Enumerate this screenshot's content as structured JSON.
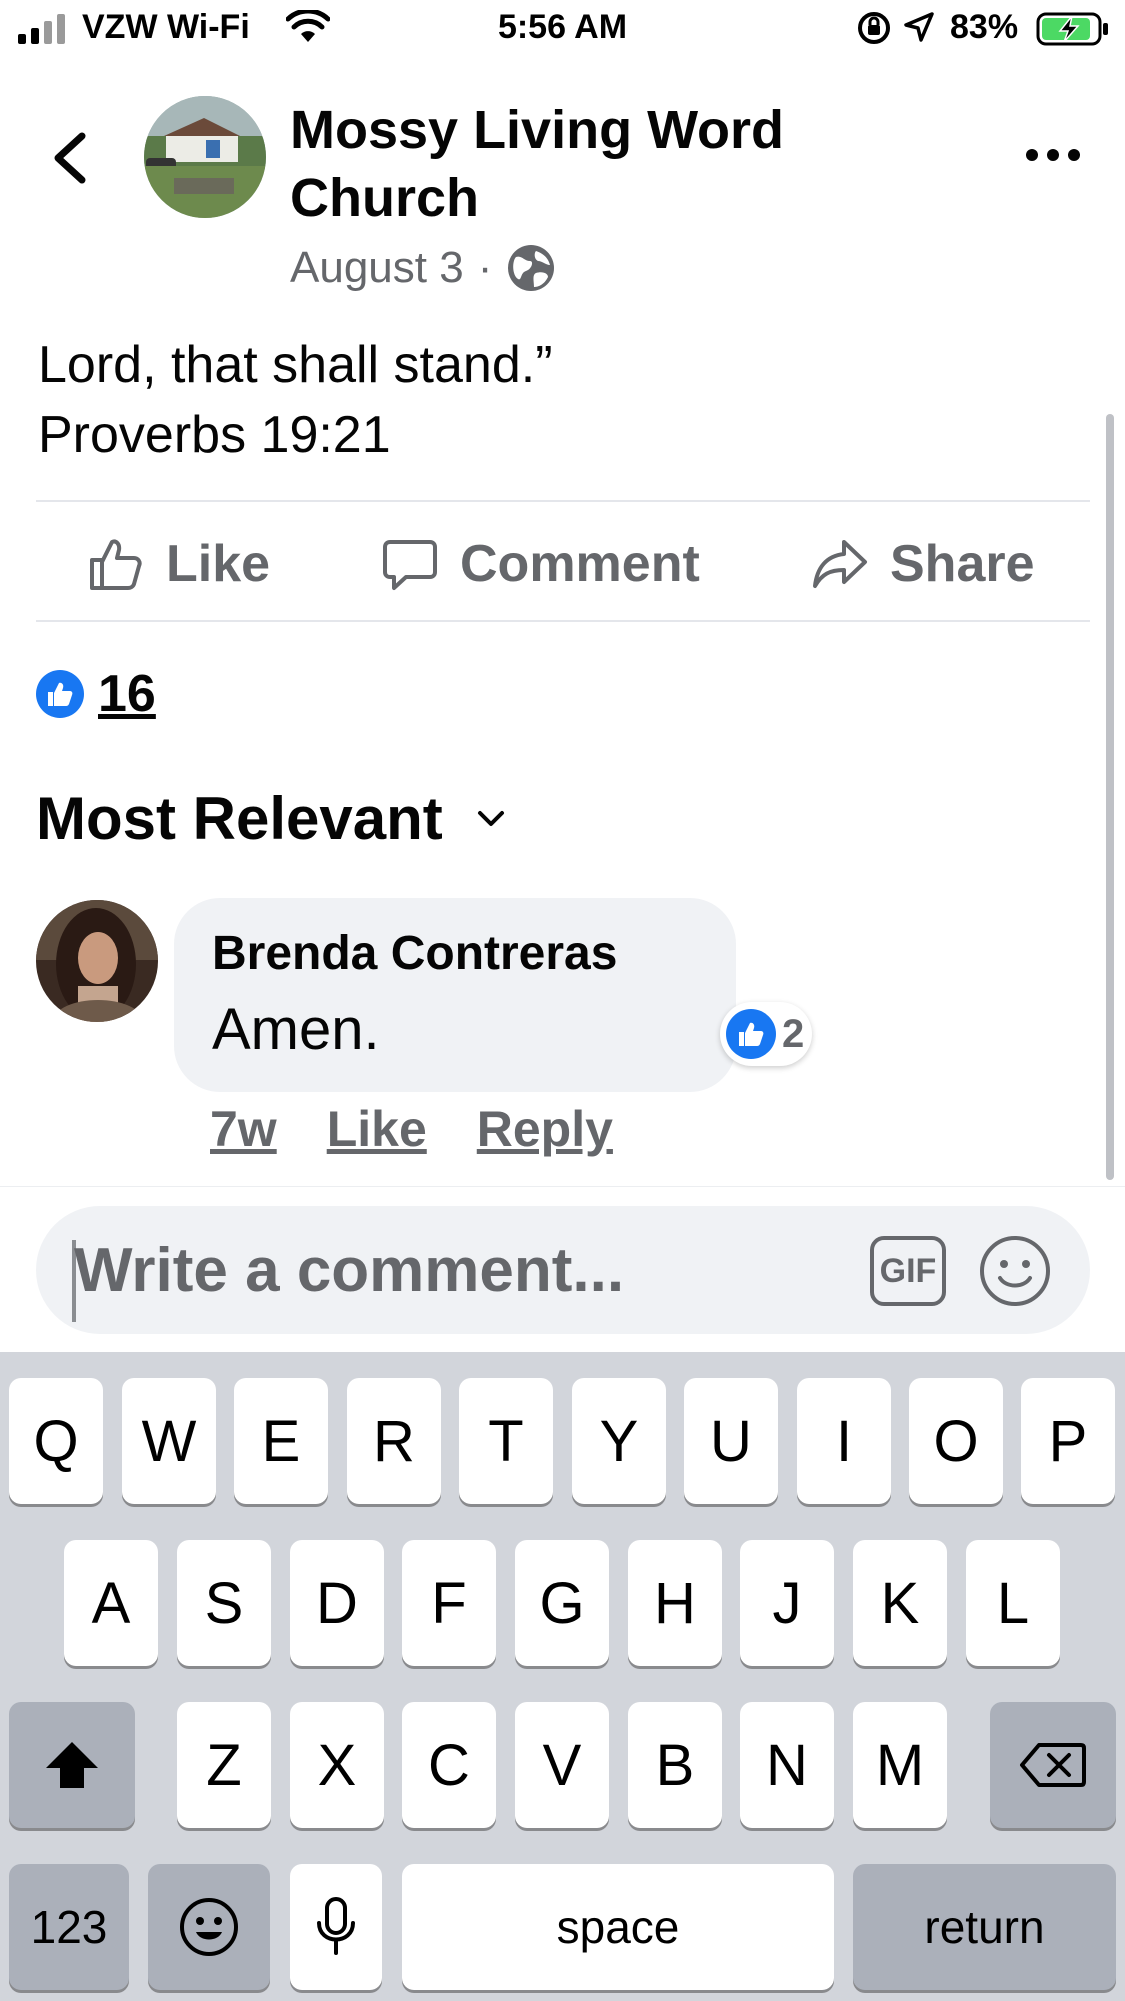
{
  "status_bar": {
    "carrier": "VZW Wi-Fi",
    "time": "5:56 AM",
    "battery": "83%"
  },
  "header": {
    "page_name": "Mossy Living Word Church",
    "date": "August 3",
    "separator": "·"
  },
  "post": {
    "text_lines": [
      "Lord, that shall stand.”",
      "Proverbs 19:21"
    ]
  },
  "actions": {
    "like": "Like",
    "comment": "Comment",
    "share": "Share"
  },
  "reactions": {
    "count": "16"
  },
  "sort": {
    "label": "Most Relevant"
  },
  "comment": {
    "author": "Brenda Contreras",
    "text": "Amen.",
    "reaction_count": "2",
    "age": "7w",
    "like": "Like",
    "reply": "Reply"
  },
  "composer": {
    "placeholder": "Write a comment...",
    "gif_label": "GIF"
  },
  "keyboard": {
    "row1": [
      "Q",
      "W",
      "E",
      "R",
      "T",
      "Y",
      "U",
      "I",
      "O",
      "P"
    ],
    "row2": [
      "A",
      "S",
      "D",
      "F",
      "G",
      "H",
      "J",
      "K",
      "L"
    ],
    "row3": [
      "Z",
      "X",
      "C",
      "V",
      "B",
      "N",
      "M"
    ],
    "numbers": "123",
    "space": "space",
    "return": "return"
  },
  "colors": {
    "brand_blue": "#1877f2",
    "secondary_text": "#65676b",
    "bubble_bg": "#f0f2f5",
    "keyboard_bg": "#d2d5db"
  }
}
